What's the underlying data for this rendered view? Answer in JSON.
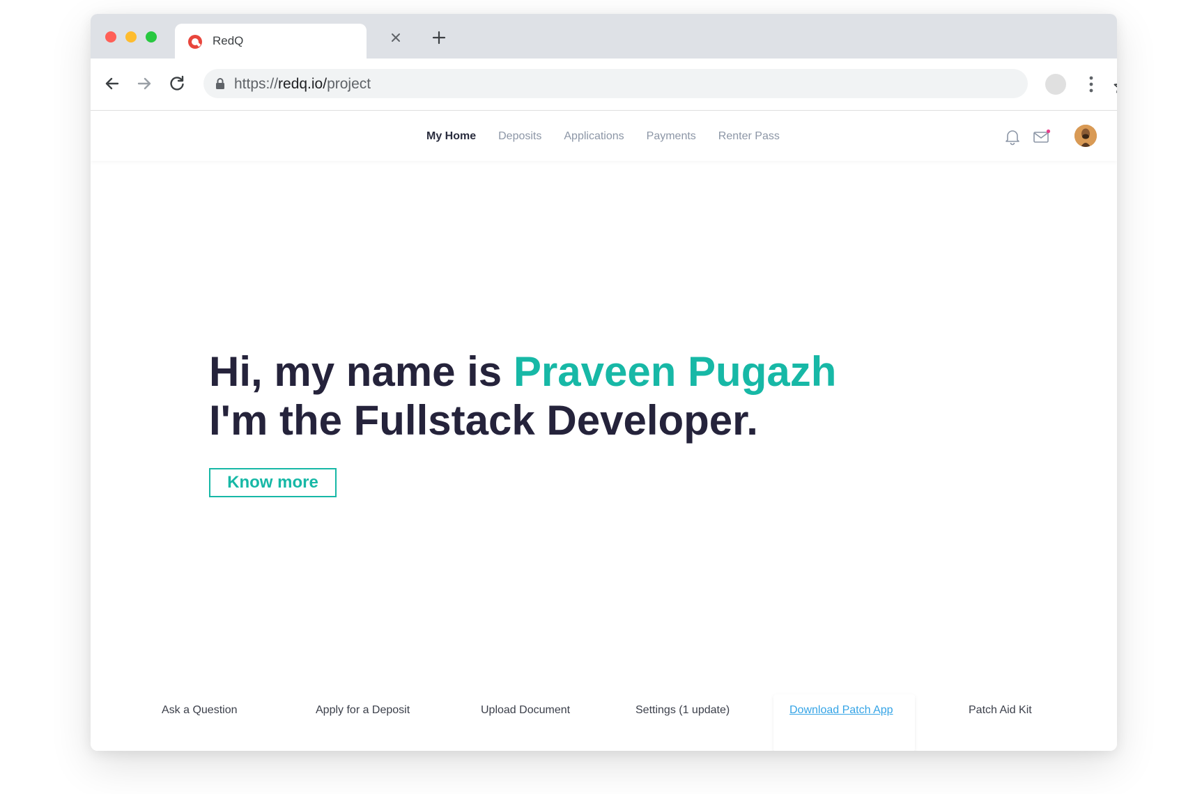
{
  "browser": {
    "tab_title": "RedQ",
    "url_scheme": "https://",
    "url_host": "redq.io/",
    "url_path": "project"
  },
  "site": {
    "nav": [
      {
        "label": "My Home",
        "active": true
      },
      {
        "label": "Deposits",
        "active": false
      },
      {
        "label": "Applications",
        "active": false
      },
      {
        "label": "Payments",
        "active": false
      },
      {
        "label": "Renter Pass",
        "active": false
      }
    ]
  },
  "hero": {
    "line1_prefix": "Hi, my name is ",
    "name": "Praveen Pugazh",
    "line2": "I'm the Fullstack Developer.",
    "cta_label": "Know more"
  },
  "footer": {
    "links": [
      "Ask a Question",
      "Apply for a Deposit",
      "Upload Document",
      "Settings (1 update)",
      "Download Patch App",
      "Patch Aid Kit"
    ]
  },
  "colors": {
    "accent": "#17b8a6",
    "heading": "#25233b",
    "link_highlight": "#35a4e6"
  },
  "icons": [
    "redq-favicon",
    "close-icon",
    "plus-icon",
    "back-arrow-icon",
    "forward-arrow-icon",
    "reload-icon",
    "lock-icon",
    "star-icon",
    "profile-icon",
    "kebab-menu-icon",
    "bell-icon",
    "mail-icon",
    "user-avatar"
  ]
}
